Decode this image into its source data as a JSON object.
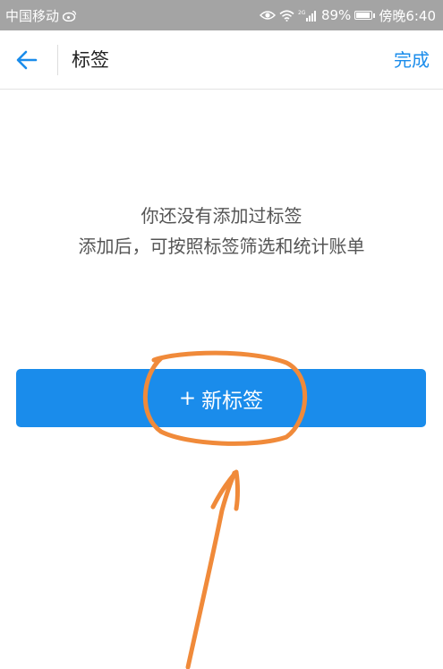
{
  "status_bar": {
    "carrier": "中国移动",
    "battery": "89%",
    "time": "傍晚6:40",
    "network": "2G",
    "battery_level": 0.89,
    "icons": [
      "weibo-icon",
      "eye-icon",
      "wifi-icon",
      "signal-icon",
      "battery-icon"
    ]
  },
  "header": {
    "back_icon": "arrow-left-icon",
    "title": "标签",
    "done_label": "完成"
  },
  "empty_state": {
    "line1": "你还没有添加过标签",
    "line2": "添加后，可按照标签筛选和统计账单"
  },
  "new_tag_button": {
    "plus": "+",
    "label": "新标签"
  },
  "colors": {
    "accent": "#1a8ceb",
    "status_bar": "#a4a4a4",
    "annotation": "#f08a3a"
  }
}
